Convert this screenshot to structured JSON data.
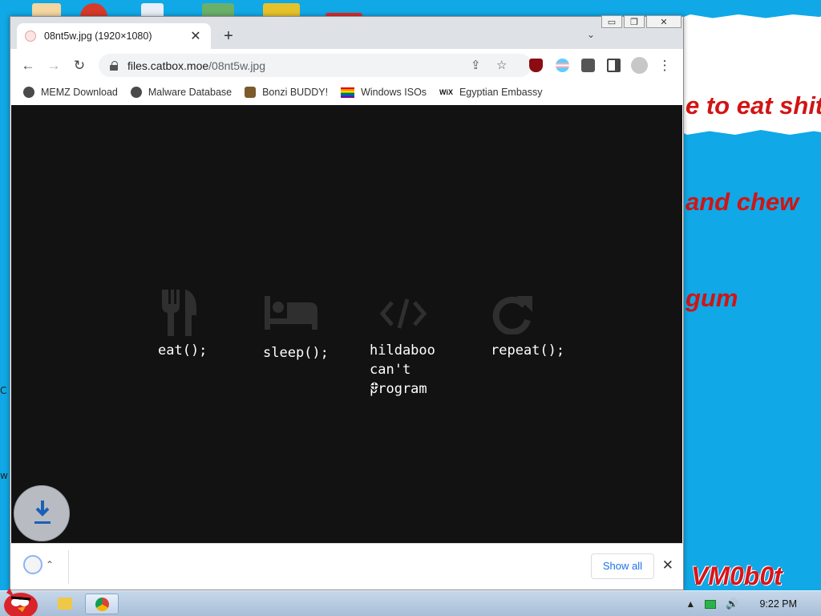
{
  "speech": {
    "lines": [
      "e to eat shit",
      " and chew",
      "gum"
    ]
  },
  "watermark": "VM0b0t",
  "side_letters": [
    "C",
    "w"
  ],
  "browser": {
    "tab": {
      "title": "08nt5w.jpg (1920×1080)",
      "close": "✕"
    },
    "new_tab": "+",
    "tab_menu": "⌄",
    "window_controls": {
      "minimize": "▭",
      "restore": "❐",
      "close": "✕"
    },
    "toolbar": {
      "back": "←",
      "forward": "→",
      "reload": "↻",
      "url_host": "files.catbox.moe",
      "url_path": "/08nt5w.jpg",
      "share": "⇪",
      "star": "☆",
      "menu": "⋮"
    },
    "bookmarks": [
      {
        "label": "MEMZ Download",
        "icon": "globe-icon"
      },
      {
        "label": "Malware Database",
        "icon": "globe-icon"
      },
      {
        "label": "Bonzi BUDDY!",
        "icon": "bonzi-icon"
      },
      {
        "label": "Windows ISOs",
        "icon": "rainbow-flag-icon"
      },
      {
        "label": "Egyptian Embassy",
        "icon": "wix-icon"
      }
    ],
    "wix_mark": "WiX"
  },
  "image": {
    "items": [
      {
        "label": "eat();",
        "icon": "utensils-icon"
      },
      {
        "label": "sleep();",
        "icon": "bed-icon"
      },
      {
        "label": "hildaboo\ncan't\nprogram",
        "icon": "code-icon"
      },
      {
        "label": "repeat();",
        "icon": "redo-icon"
      }
    ]
  },
  "download_bar": {
    "show_all": "Show all",
    "close": "✕",
    "chevron": "⌃"
  },
  "taskbar": {
    "clock": "9:22 PM",
    "tray_up": "▲"
  },
  "colors": {
    "desktop": "#10a8e6",
    "image_bg": "#121212",
    "speech_text": "#d11414",
    "link": "#1a73e8"
  }
}
